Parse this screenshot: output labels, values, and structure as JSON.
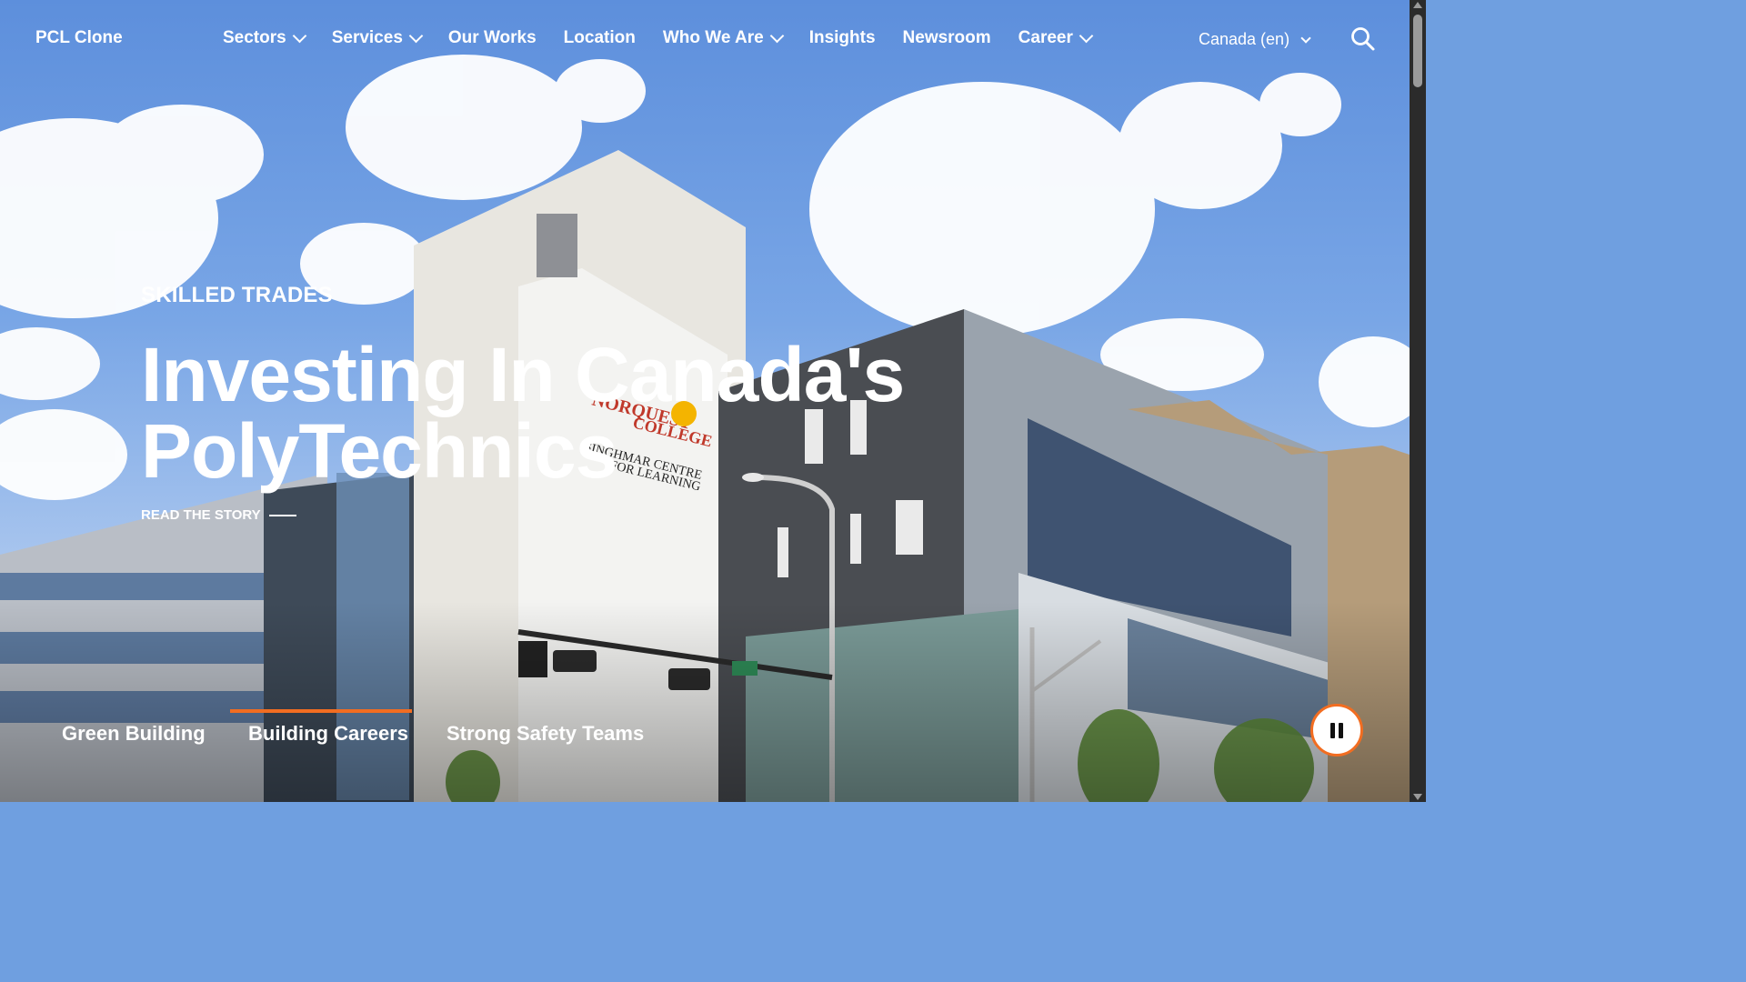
{
  "brand": {
    "logo": "PCL Clone",
    "accent": "#f26d21"
  },
  "nav": {
    "items": [
      {
        "label": "Sectors",
        "has_dropdown": true
      },
      {
        "label": "Services",
        "has_dropdown": true
      },
      {
        "label": "Our Works",
        "has_dropdown": false
      },
      {
        "label": "Location",
        "has_dropdown": false
      },
      {
        "label": "Who We Are",
        "has_dropdown": true
      },
      {
        "label": "Insights",
        "has_dropdown": false
      },
      {
        "label": "Newsroom",
        "has_dropdown": false
      },
      {
        "label": "Career",
        "has_dropdown": true
      }
    ],
    "locale": "Canada (en)",
    "search_icon": "search-icon"
  },
  "hero": {
    "eyebrow": "SKILLED TRADES",
    "headline_line1": "Investing In Canada's",
    "headline_line2": "PolyTechnics",
    "cta": "READ THE STORY"
  },
  "tabs": {
    "items": [
      "Green Building",
      "Building Careers",
      "Strong Safety Teams"
    ],
    "active_index": 1
  },
  "controls": {
    "pause_icon": "pause-icon"
  }
}
